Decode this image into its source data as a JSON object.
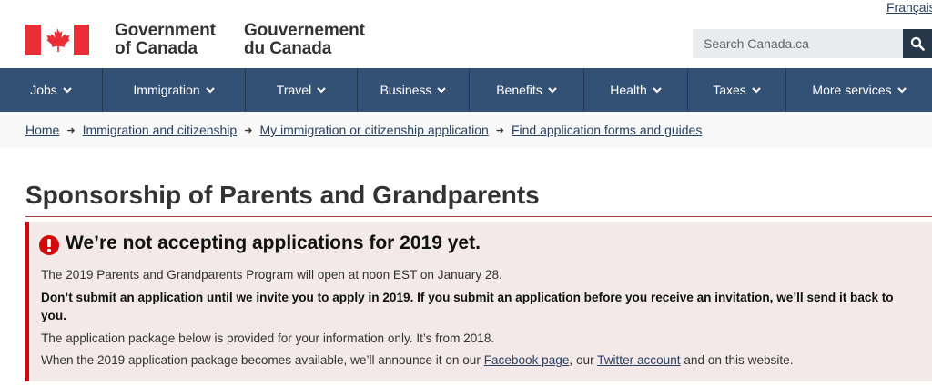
{
  "header": {
    "language_link": "Français",
    "signature_en_line1": "Government",
    "signature_en_line2": "of Canada",
    "signature_fr_line1": "Gouvernement",
    "signature_fr_line2": "du Canada",
    "search_placeholder": "Search Canada.ca",
    "colors": {
      "flag_red": "#eb2d37",
      "nav": "#335075",
      "search_button": "#26374a"
    }
  },
  "nav": {
    "items": [
      {
        "label": "Jobs"
      },
      {
        "label": "Immigration"
      },
      {
        "label": "Travel"
      },
      {
        "label": "Business"
      },
      {
        "label": "Benefits"
      },
      {
        "label": "Health"
      },
      {
        "label": "Taxes"
      },
      {
        "label": "More services"
      }
    ]
  },
  "breadcrumb": {
    "items": [
      {
        "label": "Home"
      },
      {
        "label": "Immigration and citizenship"
      },
      {
        "label": "My immigration or citizenship application"
      },
      {
        "label": "Find application forms and guides"
      }
    ]
  },
  "main": {
    "title": "Sponsorship of Parents and Grandparents",
    "alert": {
      "icon": "exclamation-circle-icon",
      "title": "We’re not accepting applications for 2019 yet.",
      "p1": "The 2019 Parents and Grandparents Program will open at noon EST on January 28.",
      "p2_line1": "Don’t submit an application until we invite you to apply in 2019. If you submit an application before you receive an invitation, we’ll send it back to",
      "p2_line2": "you.",
      "p3": "The application package below is provided for your information only. It’s from 2018.",
      "p4_before": "When the 2019 application package becomes available, we’ll announce it on our ",
      "p4_link1": "Facebook page",
      "p4_mid": ", our ",
      "p4_link2": "Twitter account",
      "p4_after": " and on this website."
    }
  }
}
